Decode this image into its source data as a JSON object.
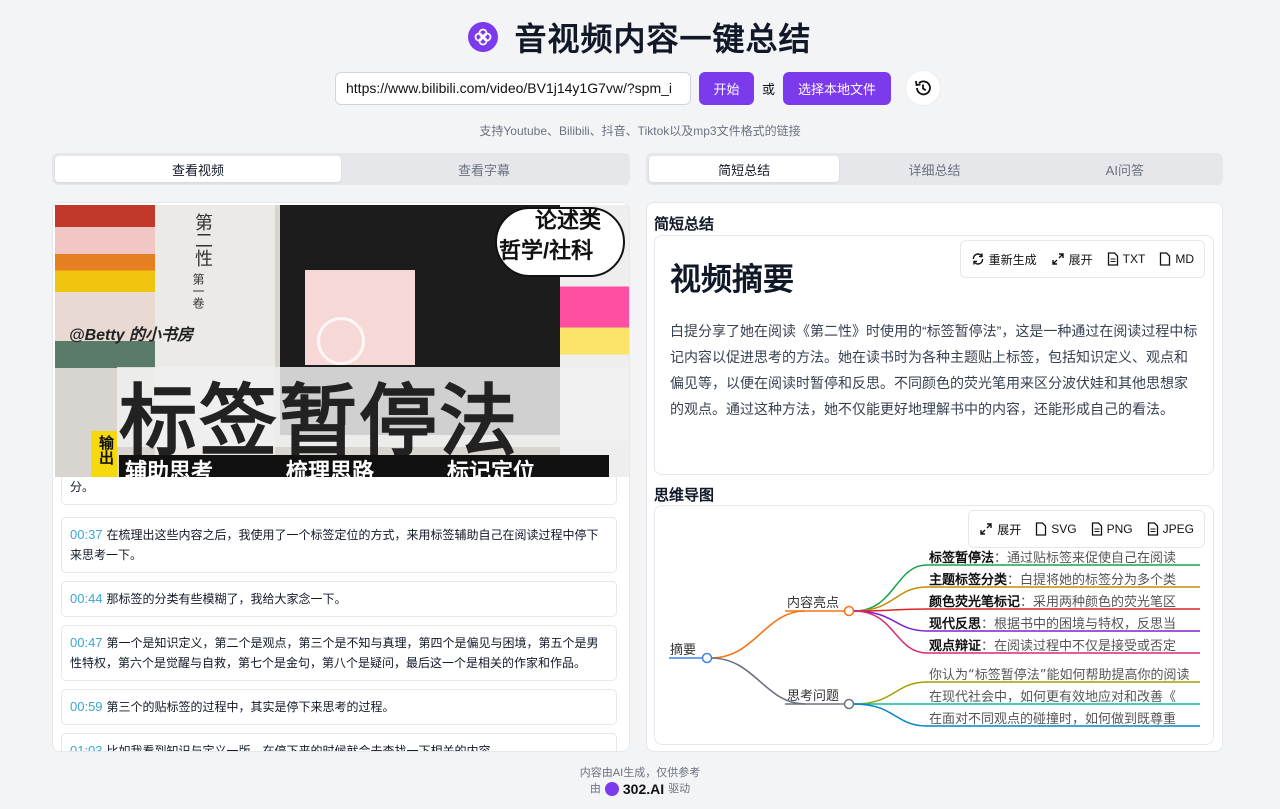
{
  "app": {
    "title": "音视频内容一键总结",
    "url_value": "https://www.bilibili.com/video/BV1j14y1G7vw/?spm_i",
    "start_label": "开始",
    "or_label": "或",
    "local_file_label": "选择本地文件",
    "support_text": "支持Youtube、Bilibili、抖音、Tiktok以及mp3文件格式的链接"
  },
  "left_tabs": [
    "查看视频",
    "查看字幕"
  ],
  "right_tabs": [
    "简短总结",
    "详细总结",
    "AI问答"
  ],
  "video": {
    "top_text": "论述类",
    "top_text2": "哲学/社科",
    "book_label": "第二性",
    "book_sub": "第一卷",
    "author_tag": "@Betty 的小书房",
    "main_title": "标签暂停法",
    "side_label": "输出",
    "bottom_items": [
      "辅助思考",
      "梳理思路",
      "标记定位"
    ]
  },
  "transcript": {
    "partial_top": "分。",
    "items": [
      {
        "time": "00:37",
        "text": "在梳理出这些内容之后，我使用了一个标签定位的方式，来用标签辅助自己在阅读过程中停下来思考一下。"
      },
      {
        "time": "00:44",
        "text": "那标签的分类有些模糊了，我给大家念一下。"
      },
      {
        "time": "00:47",
        "text": "第一个是知识定义，第二个是观点，第三个是不知与真理，第四个是偏见与困境，第五个是男性特权，第六个是觉醒与自救，第七个是金句，第八个是疑问，最后这一个是相关的作家和作品。"
      },
      {
        "time": "00:59",
        "text": "第三个的贴标签的过程中，其实是停下来思考的过程。"
      },
      {
        "time": "01:03",
        "text": "比如我看到知识与定义一版，在停下来的时候就会去查找一下相关的内容。"
      }
    ]
  },
  "summary": {
    "section_title": "简短总结",
    "heading": "视频摘要",
    "tools": [
      "重新生成",
      "展开",
      "TXT",
      "MD"
    ],
    "text": "白提分享了她在阅读《第二性》时使用的“标签暂停法”，这是一种通过在阅读过程中标记内容以促进思考的方法。她在读书时为各种主题贴上标签，包括知识定义、观点和偏见等，以便在阅读时暂停和反思。不同颜色的荧光笔用来区分波伏娃和其他思想家的观点。通过这种方法，她不仅能更好地理解书中的内容，还能形成自己的看法。"
  },
  "mindmap": {
    "section_title": "思维导图",
    "tools": [
      "展开",
      "SVG",
      "PNG",
      "JPEG"
    ],
    "root": "摘要",
    "branch1": "内容亮点",
    "branch2": "思考问题",
    "leaves1": [
      {
        "bold": "标签暂停法",
        "text": "：通过贴标签来促使自己在阅读"
      },
      {
        "bold": "主题标签分类",
        "text": "：白提将她的标签分为多个类"
      },
      {
        "bold": "颜色荧光笔标记",
        "text": "：采用两种颜色的荧光笔区"
      },
      {
        "bold": "现代反思",
        "text": "：根据书中的困境与特权，反思当"
      },
      {
        "bold": "观点辩证",
        "text": "：在阅读过程中不仅是接受或否定"
      }
    ],
    "leaves2": [
      "你认为“标签暂停法”能如何帮助提高你的阅读",
      "在现代社会中，如何更有效地应对和改善《",
      "在面对不同观点的碰撞时，如何做到既尊重"
    ],
    "colors": [
      "#16a34a",
      "#ca8a04",
      "#dc2626",
      "#7e22ce",
      "#db2777",
      "#a3a000",
      "#14b8a6",
      "#0284c7"
    ]
  },
  "footer": {
    "line1": "内容由AI生成，仅供参考",
    "prefix": "由",
    "brand": "302.AI",
    "suffix": "驱动"
  }
}
